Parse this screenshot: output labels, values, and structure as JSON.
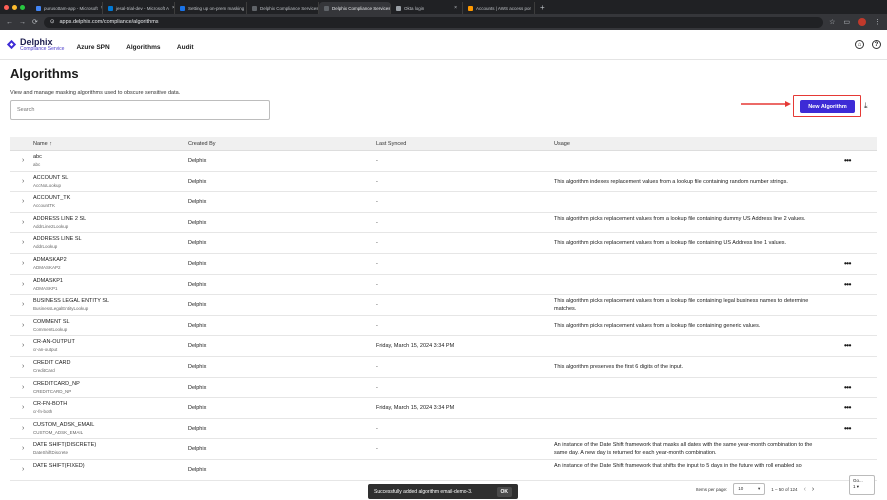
{
  "browser": {
    "tabs": [
      {
        "label": "purusottam-app - Microsoft",
        "color": "#4285f4",
        "active": false
      },
      {
        "label": "jesal-trial-dev - Microsoft A",
        "color": "#0078d4",
        "active": false
      },
      {
        "label": "Setting up on-prem masking",
        "color": "#1a73e8",
        "active": false
      },
      {
        "label": "Delphix Compliance Services",
        "color": "#5f6368",
        "active": false
      },
      {
        "label": "Delphix Compliance Services",
        "color": "#5f6368",
        "active": true
      },
      {
        "label": "Okta login",
        "color": "#9aa0a6",
        "active": false
      },
      {
        "label": "Accounts | AWS access por",
        "color": "#ff9900",
        "active": false
      }
    ],
    "new_tab": "+",
    "url": "apps.delphix.com/compliance/algorithms"
  },
  "header": {
    "logo_name": "Delphix",
    "logo_sub": "Compliance Service",
    "nav": [
      "Azure SPN",
      "Algorithms",
      "Audit"
    ],
    "account_icon": "account-circle-icon",
    "help_icon": "?"
  },
  "page": {
    "title": "Algorithms",
    "subtitle": "View and manage masking algorithms used to obscure sensitive data.",
    "search_placeholder": "Search",
    "new_button": "New Algorithm",
    "accent": "#3d2bd6",
    "highlight": "#e53935"
  },
  "table": {
    "columns": [
      "Name ↑",
      "Created By",
      "Last Synced",
      "Usage"
    ],
    "rows": [
      {
        "name": "abc",
        "sub": "abc",
        "created_by": "Delphix",
        "last_synced": "-",
        "usage": "",
        "more": true
      },
      {
        "name": "ACCOUNT SL",
        "sub": "AccNoLookup",
        "created_by": "Delphix",
        "last_synced": "-",
        "usage": "This algorithm indexes replacement values from a lookup file containing random number strings.",
        "more": false
      },
      {
        "name": "ACCOUNT_TK",
        "sub": "AccountTK",
        "created_by": "Delphix",
        "last_synced": "-",
        "usage": "",
        "more": false
      },
      {
        "name": "ADDRESS LINE 2 SL",
        "sub": "AddrLine2Lookup",
        "created_by": "Delphix",
        "last_synced": "-",
        "usage": "This algorithm picks replacement values from a lookup file containing dummy US Address line 2 values.",
        "more": false
      },
      {
        "name": "ADDRESS LINE SL",
        "sub": "AddrLookup",
        "created_by": "Delphix",
        "last_synced": "-",
        "usage": "This algorithm picks replacement values from a lookup file containing US Address line 1 values.",
        "more": false
      },
      {
        "name": "ADMASKAP2",
        "sub": "ADMASKAP2",
        "created_by": "Delphix",
        "last_synced": "-",
        "usage": "",
        "more": true
      },
      {
        "name": "ADMASKP1",
        "sub": "ADMASKP1",
        "created_by": "Delphix",
        "last_synced": "-",
        "usage": "",
        "more": true
      },
      {
        "name": "BUSINESS LEGAL ENTITY SL",
        "sub": "BusinessLegalEntityLookup",
        "created_by": "Delphix",
        "last_synced": "-",
        "usage": "This algorithm picks replacement values from a lookup file containing legal business names to determine matches.",
        "more": false
      },
      {
        "name": "COMMENT SL",
        "sub": "CommentLookup",
        "created_by": "Delphix",
        "last_synced": "-",
        "usage": "This algorithm picks replacement values from a lookup file containing generic values.",
        "more": false
      },
      {
        "name": "CR-AN-OUTPUT",
        "sub": "cr-an-output",
        "created_by": "Delphix",
        "last_synced": "Friday, March 15, 2024 3:34 PM",
        "usage": "",
        "more": true
      },
      {
        "name": "CREDIT CARD",
        "sub": "CreditCard",
        "created_by": "Delphix",
        "last_synced": "-",
        "usage": "This algorithm preserves the first 6 digits of the input.",
        "more": false
      },
      {
        "name": "CREDITCARD_NP",
        "sub": "CREDITCARD_NP",
        "created_by": "Delphix",
        "last_synced": "-",
        "usage": "",
        "more": true
      },
      {
        "name": "CR-FN-BOTH",
        "sub": "cr-fn-both",
        "created_by": "Delphix",
        "last_synced": "Friday, March 15, 2024 3:34 PM",
        "usage": "",
        "more": true
      },
      {
        "name": "CUSTOM_ADSK_EMAIL",
        "sub": "CUSTOM_ADSK_EMAIL",
        "created_by": "Delphix",
        "last_synced": "-",
        "usage": "",
        "more": true
      },
      {
        "name": "DATE SHIFT(DISCRETE)",
        "sub": "DateShiftDiscrete",
        "created_by": "Delphix",
        "last_synced": "-",
        "usage": "An instance of the Date Shift framework that masks all dates with the same year-month combination to the same day. A new day is returned for each year-month combination.",
        "more": false
      },
      {
        "name": "DATE SHIFT(FIXED)",
        "sub": "",
        "created_by": "Delphix",
        "last_synced": "",
        "usage": "An instance of the Date Shift framework that shifts the input to 5 days in the future with roll enabled so",
        "more": false
      }
    ]
  },
  "toast": {
    "message": "Successfully added algorithm email-demo-3.",
    "ok": "OK"
  },
  "pagination": {
    "items_per_page_label": "Items per page:",
    "per_page": "10",
    "range": "1 – 50 of 124",
    "go_label": "Go...",
    "page": "1"
  }
}
